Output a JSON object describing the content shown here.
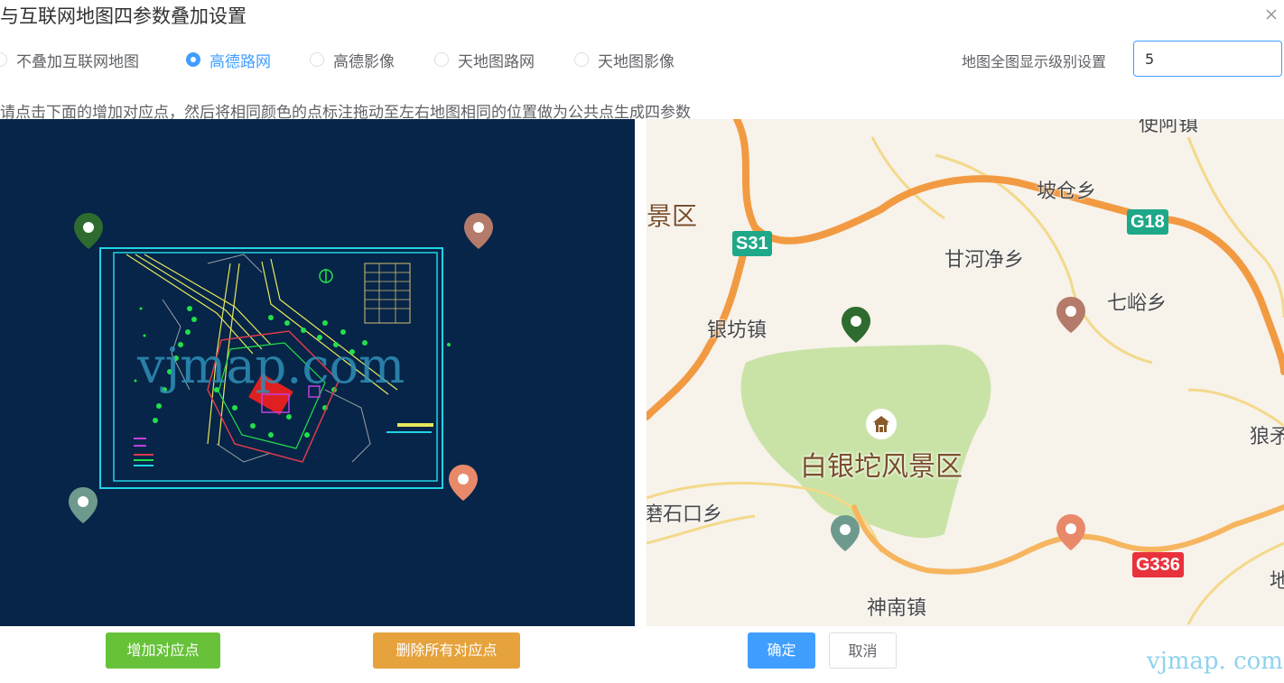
{
  "dialog": {
    "title": "与互联网地图四参数叠加设置"
  },
  "options": {
    "items": [
      {
        "label": "不叠加互联网地图",
        "checked": false
      },
      {
        "label": "高德路网",
        "checked": true
      },
      {
        "label": "高德影像",
        "checked": false
      },
      {
        "label": "天地图路网",
        "checked": false
      },
      {
        "label": "天地图影像",
        "checked": false
      }
    ]
  },
  "zoom": {
    "label": "地图全图显示级别设置",
    "value": "5"
  },
  "instruction": "请点击下面的增加对应点，然后将相同颜色的点标注拖动至左右地图相同的位置做为公共点生成四参数",
  "cad": {
    "watermark": "vjmap.com",
    "markers": [
      {
        "name": "dark-green",
        "color": "#2e6b2e"
      },
      {
        "name": "brown",
        "color": "#b47a6a"
      },
      {
        "name": "gray-green",
        "color": "#6e9a8e"
      },
      {
        "name": "orange",
        "color": "#e8896a"
      }
    ]
  },
  "map": {
    "places": {
      "podang": "坡仓乡",
      "ganhe": "甘河净乡",
      "qiyu": "七峪乡",
      "yinfang": "银坊镇",
      "scenic": "白银坨风景区",
      "shishi": "磨石口乡",
      "shennan": "神南镇",
      "jingqu": "景区",
      "langxi": "狼矛",
      "top": "使阿镇",
      "edge": "地"
    },
    "roads": {
      "s31": "S31",
      "g18": "G18",
      "g336": "G336"
    }
  },
  "buttons": {
    "add": "增加对应点",
    "delete_all": "删除所有对应点",
    "ok": "确定",
    "cancel": "取消"
  },
  "footer_watermark": "vjmap. com",
  "colors": {
    "primary": "#409eff",
    "success": "#67c23a",
    "warning": "#e6a23c",
    "cad_background": "#062548"
  }
}
